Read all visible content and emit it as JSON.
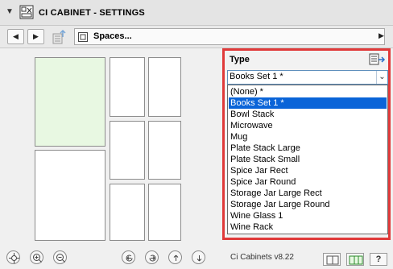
{
  "window": {
    "title": "CI CABINET - SETTINGS"
  },
  "toolbar": {
    "spaces_label": "Spaces..."
  },
  "type_panel": {
    "label": "Type",
    "selected": "Books Set 1 *",
    "options": [
      "(None) *",
      "Books Set 1 *",
      "Bowl Stack",
      "Microwave",
      "Mug",
      "Plate Stack Large",
      "Plate Stack Small",
      "Spice Jar Rect",
      "Spice Jar Round",
      "Storage Jar Large Rect",
      "Storage Jar Large Round",
      "Wine Glass 1",
      "Wine Rack"
    ],
    "selected_index": 1
  },
  "footer": {
    "version": "Ci Cabinets v8.22"
  },
  "colors": {
    "accent_red": "#e03a3a",
    "selection_blue": "#0a64d8",
    "preview_green": "#e8f8e2"
  }
}
